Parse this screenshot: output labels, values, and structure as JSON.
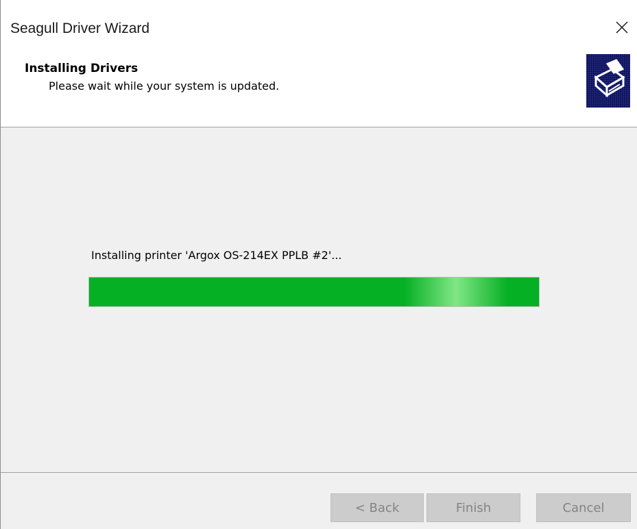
{
  "window": {
    "title": "Seagull Driver Wizard"
  },
  "header": {
    "title": "Installing Drivers",
    "subtitle": "Please wait while your system is updated.",
    "icon": "printer-install-icon"
  },
  "main": {
    "status_text": "Installing printer 'Argox OS-214EX PPLB #2'...",
    "progress": {
      "percent": 100,
      "color": "#06b025",
      "disabled_button_color": "#cccccc"
    }
  },
  "footer": {
    "back_label": "< Back",
    "finish_label": "Finish",
    "cancel_label": "Cancel"
  },
  "icons": {
    "close": "close-icon",
    "wizard_image": "printer-install-icon"
  }
}
